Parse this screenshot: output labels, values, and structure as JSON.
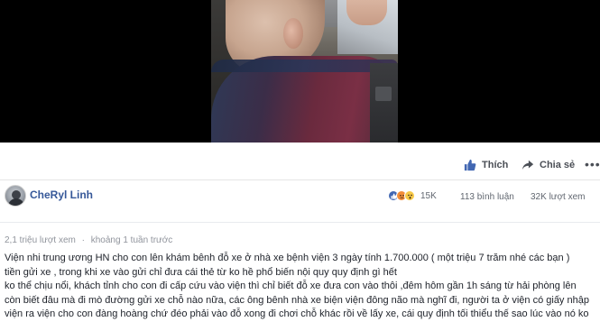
{
  "actions": {
    "like_label": "Thích",
    "share_label": "Chia sẻ",
    "more_label": "•••"
  },
  "post": {
    "author": "CheRyl Linh",
    "reactions_count": "15K",
    "comments": "113 bình luận",
    "views": "32K lượt xem",
    "view_count_meta": "2,1 triệu lượt xem",
    "separator": "·",
    "time_meta": "khoảng 1 tuần trước",
    "reaction_icons": [
      "like-icon",
      "angry-icon",
      "wow-icon"
    ]
  },
  "description": [
    "Viện nhi trung ương HN cho con lên khám bênh đỗ xe ở nhà xe bệnh viện 3 ngày tính 1.700.000 ( một triệu 7 trăm nhé các bạn )",
    "tiền gửi xe , trong khi xe vào gửi chỉ đưa cái thẻ từ ko hề phổ biến nội quy quy định gì hết",
    "ko thể chịu nổi, khách tỉnh cho con đi cấp cứu vào viện thì chỉ biết đỗ xe đưa con vào thôi ,đêm hôm gần 1h sáng từ hải phòng lên",
    "còn biết đâu mà đi mò đường gửi xe chỗ nào nữa, các ông bênh nhà xe biện viện đông não mà nghĩ đi, người ta ở viện có giấy nhập",
    "viện ra viện cho con đàng hoàng chứ đéo phải vào đỗ xong đi chơi chỗ khác rồi về lấy xe, cái quy định tối thiểu thế sao lúc vào nó ko"
  ],
  "colors": {
    "link": "#365899",
    "secondary_text": "#616770",
    "meta_text": "#90949c"
  }
}
